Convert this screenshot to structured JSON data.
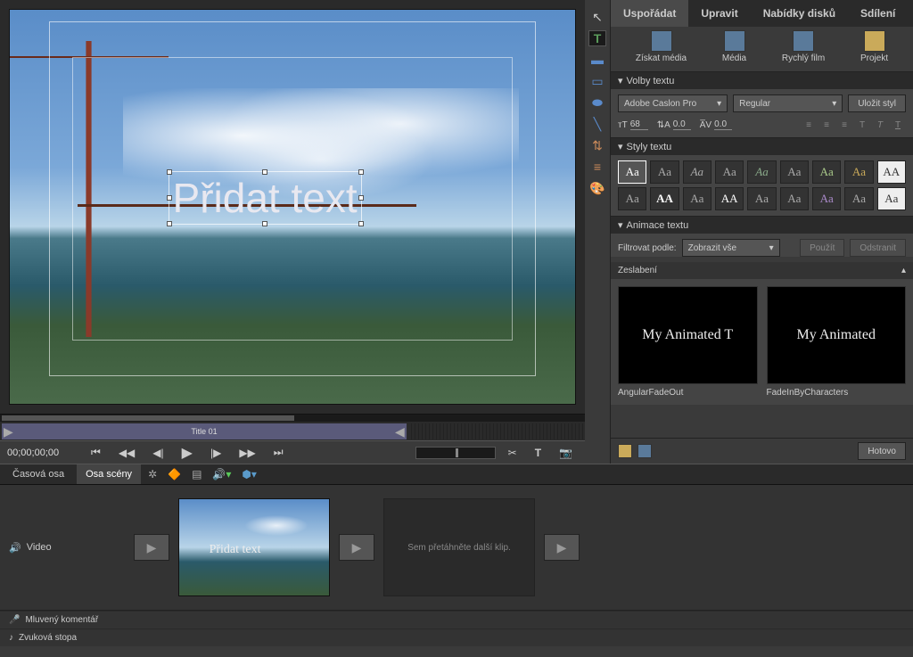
{
  "preview": {
    "overlay_text": "Přidat text"
  },
  "timeline": {
    "clip_label": "Title 01",
    "timecode": "00;00;00;00"
  },
  "tabs": {
    "main": [
      "Uspořádat",
      "Upravit",
      "Nabídky disků",
      "Sdílení"
    ],
    "active": 0,
    "sub": [
      "Získat média",
      "Média",
      "Rychlý film",
      "Projekt"
    ]
  },
  "text_options": {
    "header": "Volby textu",
    "font_family": "Adobe Caslon Pro",
    "font_style": "Regular",
    "save_style": "Uložit styl",
    "size": "68",
    "leading": "0.0",
    "tracking": "0.0"
  },
  "text_styles": {
    "header": "Styly textu",
    "swatches": [
      "Aa",
      "Aa",
      "Aa",
      "Aa",
      "Aa",
      "Aa",
      "Aa",
      "Aa",
      "AA",
      "Aa",
      "AA",
      "Aa",
      "AA",
      "Aa",
      "Aa",
      "Aa",
      "Aa",
      "Aa"
    ]
  },
  "text_anim": {
    "header": "Animace textu",
    "filter_label": "Filtrovat podle:",
    "filter_value": "Zobrazit vše",
    "apply": "Použít",
    "remove": "Odstranit",
    "group": "Zeslabení",
    "items": [
      {
        "preview": "My Animated T",
        "name": "AngularFadeOut"
      },
      {
        "preview": "My Animated",
        "name": "FadeInByCharacters"
      }
    ]
  },
  "footer": {
    "done": "Hotovo"
  },
  "bottom": {
    "tabs": [
      "Časová osa",
      "Osa scény"
    ],
    "active": 1,
    "video_label": "Video",
    "dropzone": "Sem přetáhněte další klip.",
    "clip_overlay": "Přidat text",
    "commentary": "Mluvený komentář",
    "soundtrack": "Zvuková stopa"
  }
}
